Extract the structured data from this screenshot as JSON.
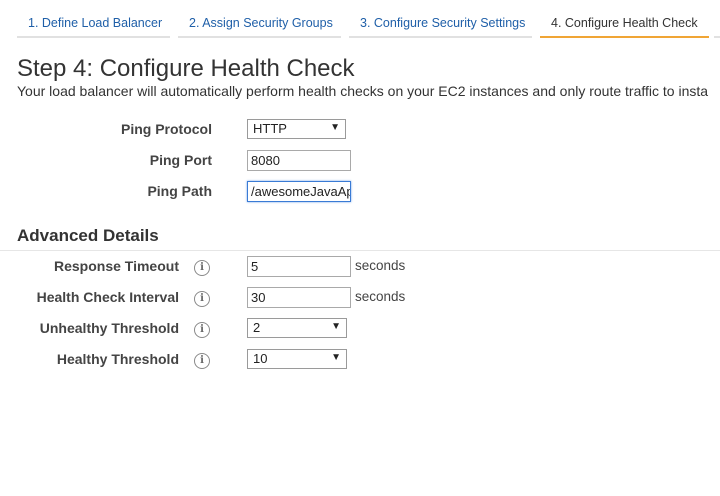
{
  "wizard": {
    "tabs": [
      {
        "label": "1. Define Load Balancer"
      },
      {
        "label": "2. Assign Security Groups"
      },
      {
        "label": "3. Configure Security Settings"
      },
      {
        "label": "4. Configure Health Check",
        "active": true
      }
    ]
  },
  "page": {
    "title": "Step 4: Configure Health Check",
    "description": "Your load balancer will automatically perform health checks on your EC2 instances and only route traffic to insta"
  },
  "ping": {
    "protocol_label": "Ping Protocol",
    "protocol_value": "HTTP",
    "port_label": "Ping Port",
    "port_value": "8080",
    "path_label": "Ping Path",
    "path_value": "/awesomeJavaAp"
  },
  "advanced": {
    "title": "Advanced Details",
    "response_timeout": {
      "label": "Response Timeout",
      "value": "5",
      "unit": "seconds"
    },
    "health_check_interval": {
      "label": "Health Check Interval",
      "value": "30",
      "unit": "seconds"
    },
    "unhealthy_threshold": {
      "label": "Unhealthy Threshold",
      "value": "2"
    },
    "healthy_threshold": {
      "label": "Healthy Threshold",
      "value": "10"
    }
  },
  "icons": {
    "info": "info-icon",
    "dropdown": "triangle-down-icon",
    "info_glyph": "i",
    "arrow_glyph": "▼"
  },
  "colors": {
    "tab_link": "#1f5fa8",
    "active_tab_underline": "#f0a535",
    "focus_border": "#3a7bd5"
  }
}
